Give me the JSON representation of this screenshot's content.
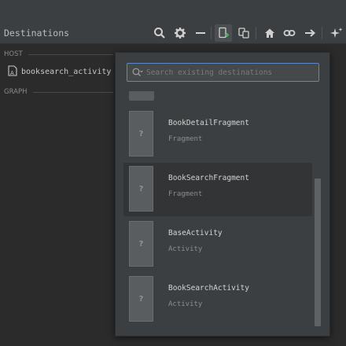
{
  "toolbar": {
    "title": "Destinations",
    "icons": [
      "search-icon",
      "gear-icon",
      "minimize-icon",
      "new-destination-icon",
      "embed-graph-icon",
      "home-icon",
      "link-icon",
      "action-arrow-icon",
      "auto-arrange-icon"
    ]
  },
  "tree": {
    "host_label": "HOST",
    "host_item": "booksearch_activity",
    "graph_label": "GRAPH"
  },
  "popup": {
    "search_placeholder": "Search existing destinations",
    "search_value": "",
    "thumbnail_glyph": "?",
    "items": [
      {
        "name": "BookDetailFragment",
        "type": "Fragment"
      },
      {
        "name": "BookSearchFragment",
        "type": "Fragment"
      },
      {
        "name": "BaseActivity",
        "type": "Activity"
      },
      {
        "name": "BookSearchActivity",
        "type": "Activity"
      }
    ]
  },
  "colors": {
    "background": "#2b2b2b",
    "toolbar": "#3c3f41",
    "accent": "#5a87c5",
    "new_destination_green": "#59a869"
  }
}
